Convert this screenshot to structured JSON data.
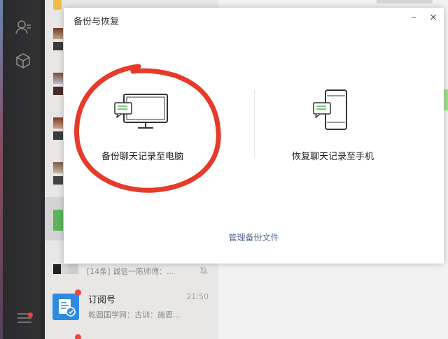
{
  "dialog": {
    "title": "备份与恢复",
    "minimize_glyph": "–",
    "close_glyph": "×",
    "backup_option_label": "备份聊天记录至电脑",
    "restore_option_label": "恢复聊天记录至手机",
    "manage_link": "管理备份文件"
  },
  "chat_list": {
    "group_item": {
      "subtitle": "[14条] 诚信一陈师傅：...",
      "muted_icon": "bell-muted-icon"
    },
    "subscription_item": {
      "title": "订阅号",
      "time": "21:50",
      "subtitle": "乾圆国学网：古训：施恩..."
    }
  },
  "colors": {
    "accent_green": "#7bc47a",
    "annotation_red": "#e63b2a",
    "link_blue": "#576b95",
    "badge_red": "#f2433e"
  }
}
